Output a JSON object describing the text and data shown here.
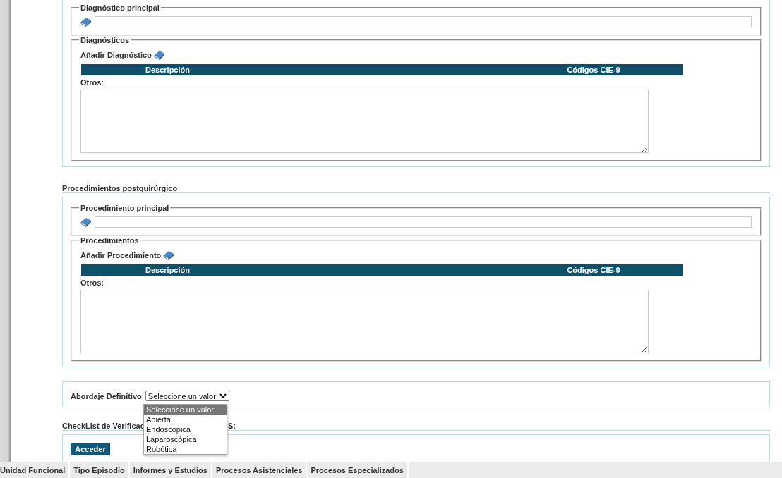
{
  "sections": [
    {
      "principal_legend": "Diagnóstico principal",
      "list_legend": "Diagnósticos",
      "add_label": "Añadir Diagnóstico",
      "columns": [
        "Descripción",
        "Códigos CIE-9"
      ],
      "others_label": "Otros:"
    },
    {
      "heading": "Procedimientos postquirúrgico",
      "principal_legend": "Procedimiento principal",
      "list_legend": "Procedimientos",
      "add_label": "Añadir Procedimiento",
      "columns": [
        "Descripción",
        "Códigos CIE-9"
      ],
      "others_label": "Otros:"
    }
  ],
  "abordaje": {
    "label": "Abordaje Definitivo",
    "value": "Seleccione un valor",
    "expanded": true,
    "options": [
      {
        "label": "Seleccione un valor",
        "selected": true
      },
      {
        "label": "Abierta",
        "selected": false
      },
      {
        "label": "Endoscópica",
        "selected": false
      },
      {
        "label": "Laparoscópica",
        "selected": false
      },
      {
        "label": "Robótica",
        "selected": false
      }
    ]
  },
  "checklist": {
    "heading_parts": [
      "CheckList de Verificac",
      "S:"
    ],
    "button": "Acceder"
  },
  "bottom_tabs": [
    "Unidad Funcional",
    "Tipo Episodio",
    "Informes y Estudios",
    "Procesos Asistenciales",
    "Procesos Especializados"
  ]
}
